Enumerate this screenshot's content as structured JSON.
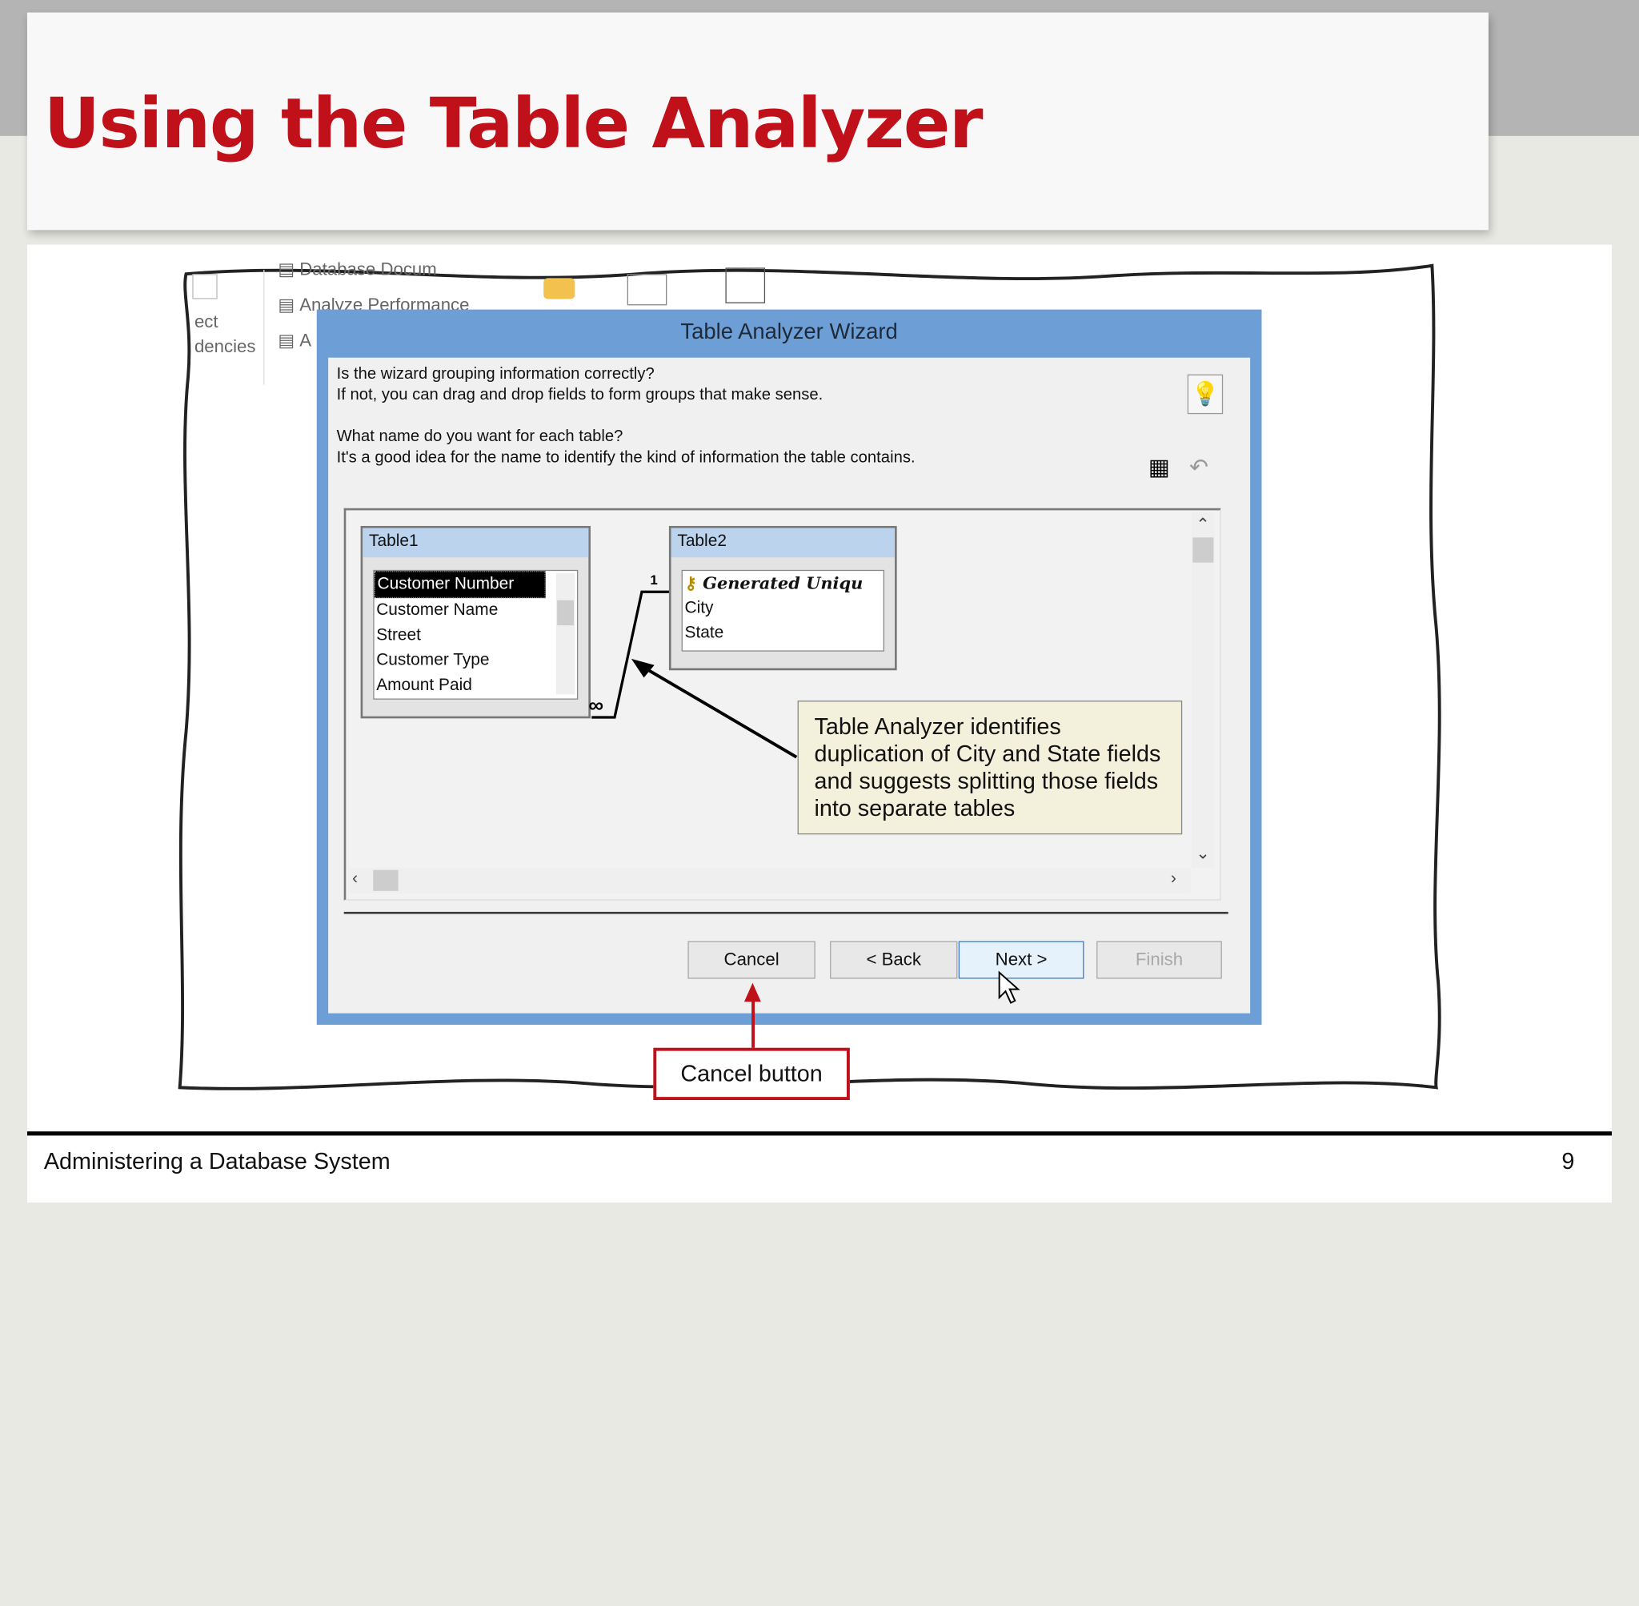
{
  "slide": {
    "title": "Using the Table Analyzer",
    "footer": "Administering a Database System",
    "page_number": "9",
    "title_color": "#c0101a"
  },
  "ribbon": {
    "items": [
      "Database Docum",
      "Analyze Performance",
      "A"
    ],
    "left_partial": [
      "ect",
      "dencies"
    ]
  },
  "wizard": {
    "title": "Table Analyzer Wizard",
    "line1": "Is the wizard grouping information correctly?",
    "line2": "If not, you can drag and drop fields to form groups that make sense.",
    "line3": "What name do you want for each table?",
    "line4": "It's a good idea for the name to identify the kind of information the table contains.",
    "icons": [
      "lightbulb-icon",
      "rename-table-icon",
      "undo-icon"
    ],
    "table1": {
      "name": "Table1",
      "fields": [
        "Customer Number",
        "Customer Name",
        "Street",
        "Customer Type",
        "Amount Paid"
      ]
    },
    "table2": {
      "name": "Table2",
      "fields": [
        "Generated Uniqu",
        "City",
        "State"
      ]
    },
    "relation": {
      "one": "1",
      "many": "∞"
    },
    "buttons": {
      "cancel": "Cancel",
      "back": "< Back",
      "next": "Next >",
      "finish": "Finish"
    }
  },
  "callouts": {
    "analyzer": "Table Analyzer identifies duplication of City and State fields and suggests splitting those fields into separate tables",
    "cancel": "Cancel button"
  }
}
